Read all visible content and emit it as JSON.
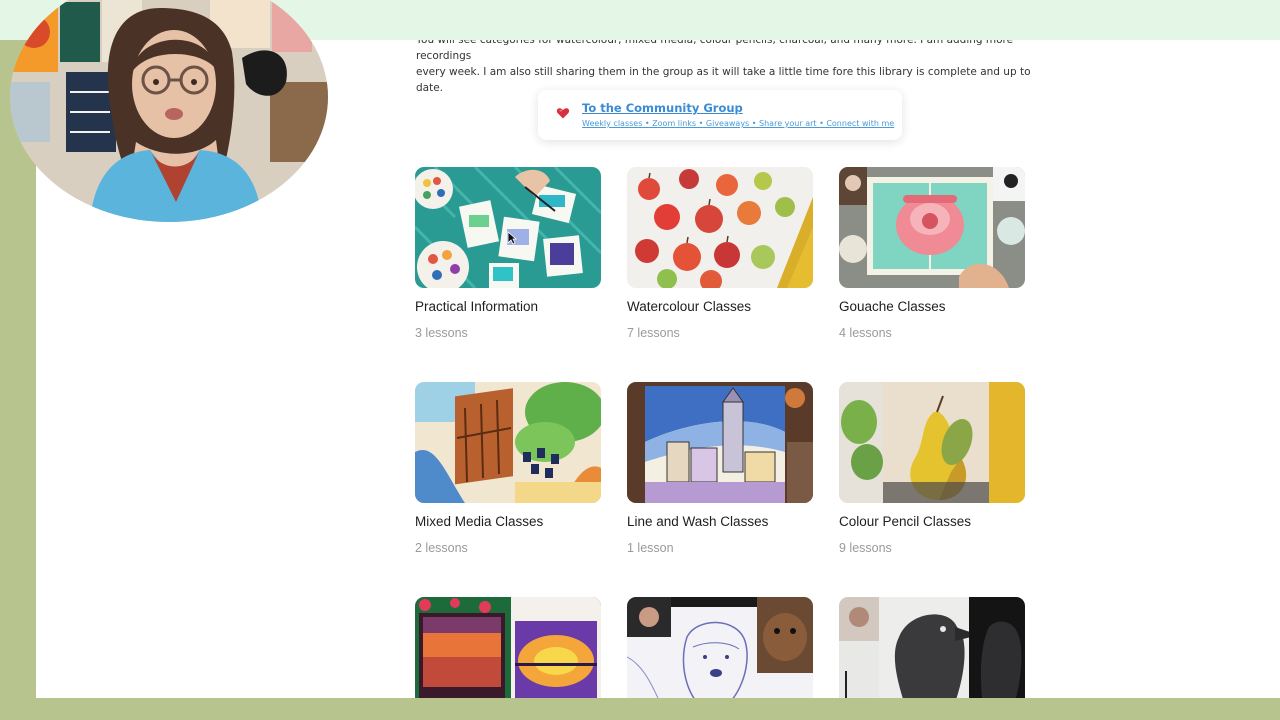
{
  "intro": {
    "line1": "You will see categories for watercolour, mixed media, colour pencils, charcoal, and many more. I am adding more recordings",
    "line2": "every week. I am also still sharing them in the group as it will take a little time fore this library is complete and up to date."
  },
  "community": {
    "icon": "heart-icon",
    "title": "To the Community Group",
    "subtitle": "Weekly classes • Zoom links • Giveaways • Share your art • Connect with me"
  },
  "categories": [
    {
      "title": "Practical Information",
      "lessons": "3 lessons",
      "image": "watercolour-swatches-on-teal-cloth"
    },
    {
      "title": "Watercolour Classes",
      "lessons": "7 lessons",
      "image": "watercolour-apples"
    },
    {
      "title": "Gouache Classes",
      "lessons": "4 lessons",
      "image": "gouache-rotary-phone"
    },
    {
      "title": "Mixed Media Classes",
      "lessons": "2 lessons",
      "image": "mixed-media-garden-gate"
    },
    {
      "title": "Line and Wash Classes",
      "lessons": "1 lesson",
      "image": "line-and-wash-winter-town"
    },
    {
      "title": "Colour Pencil Classes",
      "lessons": "9 lessons",
      "image": "colour-pencil-pear"
    },
    {
      "title": "",
      "lessons": "",
      "image": "sunset-landscape-painting"
    },
    {
      "title": "",
      "lessons": "",
      "image": "bear-sketch"
    },
    {
      "title": "",
      "lessons": "",
      "image": "charcoal-raven"
    }
  ],
  "webcam": {
    "icon": "presenter-webcam"
  },
  "colors": {
    "frame": "#b7c48d",
    "top_band": "#e4f6e6",
    "link": "#3b8bd4",
    "title": "#1e1e1e",
    "count": "#9a9a9a"
  }
}
